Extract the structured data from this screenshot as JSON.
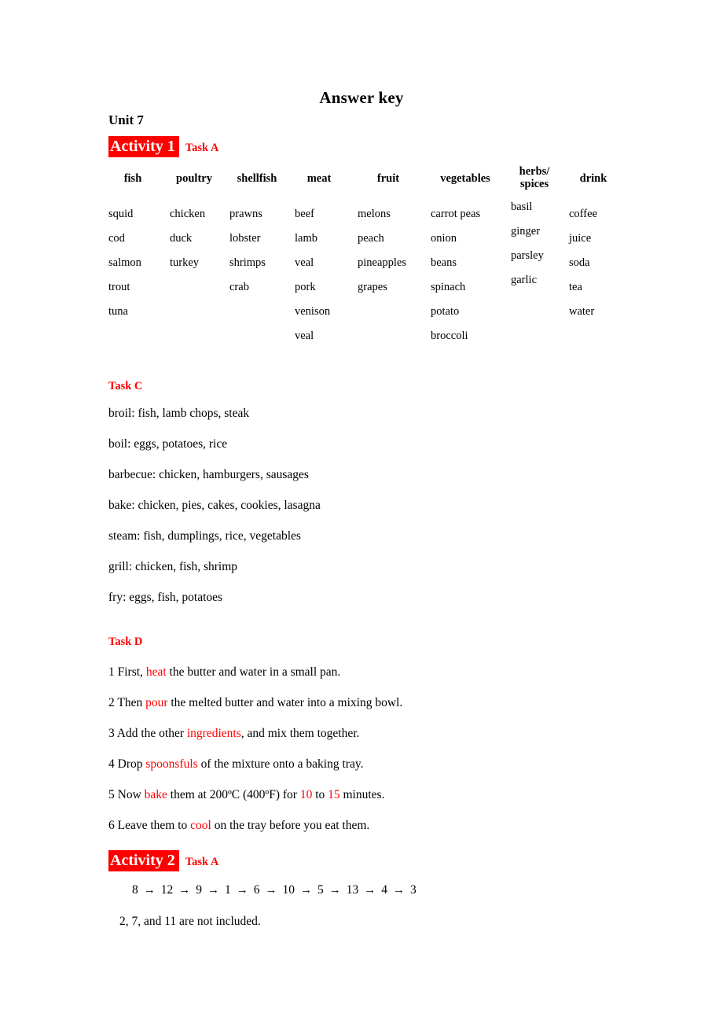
{
  "document": {
    "title": "Answer key",
    "unit": "Unit 7"
  },
  "activity1": {
    "badge": "Activity 1",
    "task_label": "Task A"
  },
  "table": {
    "headers": [
      {
        "line1": "fish",
        "line2": ""
      },
      {
        "line1": "poultry",
        "line2": ""
      },
      {
        "line1": "shellfish",
        "line2": ""
      },
      {
        "line1": "meat",
        "line2": ""
      },
      {
        "line1": "fruit",
        "line2": ""
      },
      {
        "line1": "vegetables",
        "line2": ""
      },
      {
        "line1": "herbs/",
        "line2": "spices"
      },
      {
        "line1": "drink",
        "line2": ""
      }
    ],
    "columns": [
      [
        "squid",
        "cod",
        "salmon",
        "trout",
        "tuna",
        ""
      ],
      [
        "chicken",
        "duck",
        "turkey",
        "",
        "",
        ""
      ],
      [
        "prawns",
        "lobster",
        "shrimps",
        "crab",
        "",
        ""
      ],
      [
        "beef",
        "lamb",
        "veal",
        "pork",
        "venison",
        "veal"
      ],
      [
        "melons",
        "peach",
        "pineapples",
        "grapes",
        "",
        ""
      ],
      [
        "carrot peas",
        "onion",
        "beans",
        "spinach",
        "potato",
        "broccoli"
      ],
      [
        "basil",
        "ginger",
        "parsley",
        "garlic",
        "",
        ""
      ],
      [
        "coffee",
        "juice",
        "soda",
        "tea",
        "water",
        ""
      ]
    ]
  },
  "task_c": {
    "heading": "Task C",
    "lines": [
      "broil: fish, lamb chops, steak",
      "boil: eggs, potatoes, rice",
      "barbecue: chicken, hamburgers, sausages",
      "bake: chicken, pies, cakes, cookies, lasagna",
      "steam: fish, dumplings, rice, vegetables",
      "grill: chicken, fish, shrimp",
      "fry: eggs, fish, potatoes"
    ]
  },
  "task_d": {
    "heading": "Task D",
    "steps": [
      {
        "pre": "1 First, ",
        "hl1": "heat",
        "mid": " the butter and water in a small pan.",
        "hl2": "",
        "post": ""
      },
      {
        "pre": "2 Then ",
        "hl1": "pour",
        "mid": " the melted butter and water into a mixing bowl.",
        "hl2": "",
        "post": ""
      },
      {
        "pre": "3 Add the other ",
        "hl1": "ingredients",
        "mid": ", and mix them together.",
        "hl2": "",
        "post": ""
      },
      {
        "pre": "4 Drop ",
        "hl1": "spoonsfuls",
        "mid": " of the mixture onto a baking tray.",
        "hl2": "",
        "post": ""
      },
      {
        "pre": "5 Now ",
        "hl1": "bake",
        "mid": " them at 200ºC (400ºF) for ",
        "hl2": "10",
        "post": " to ",
        "hl3": "15",
        "tail": " minutes."
      },
      {
        "pre": "6 Leave them to ",
        "hl1": "cool",
        "mid": " on the tray before you eat them.",
        "hl2": "",
        "post": ""
      }
    ]
  },
  "activity2": {
    "badge": "Activity 2",
    "task_label": "Task A",
    "sequence": [
      "8",
      "12",
      "9",
      "1",
      "6",
      "10",
      "5",
      "13",
      "4",
      "3"
    ],
    "arrow": "→",
    "note": "2, 7, and 11 are not included."
  },
  "colors": {
    "highlight_bg": "#FF0000",
    "highlight_text": "#FFFFFF",
    "accent_red": "#FF0000",
    "body_text": "#000000"
  }
}
